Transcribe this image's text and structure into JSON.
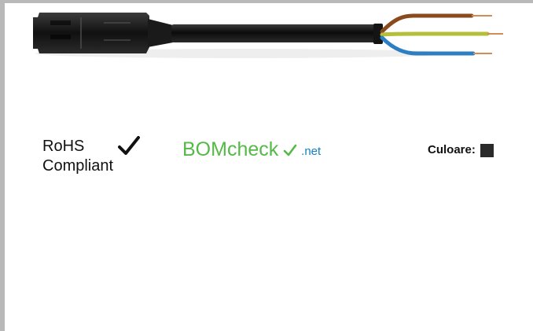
{
  "product": {
    "image_name": "connector-cable-icon"
  },
  "certification": {
    "line1": "RoHS",
    "line2": "Compliant",
    "check_icon_name": "check-icon"
  },
  "logo": {
    "main": "BOMcheck",
    "net": ".net",
    "check_icon_name": "check-icon"
  },
  "color": {
    "label": "Culoare:",
    "swatch_color": "#2a2a2a"
  }
}
